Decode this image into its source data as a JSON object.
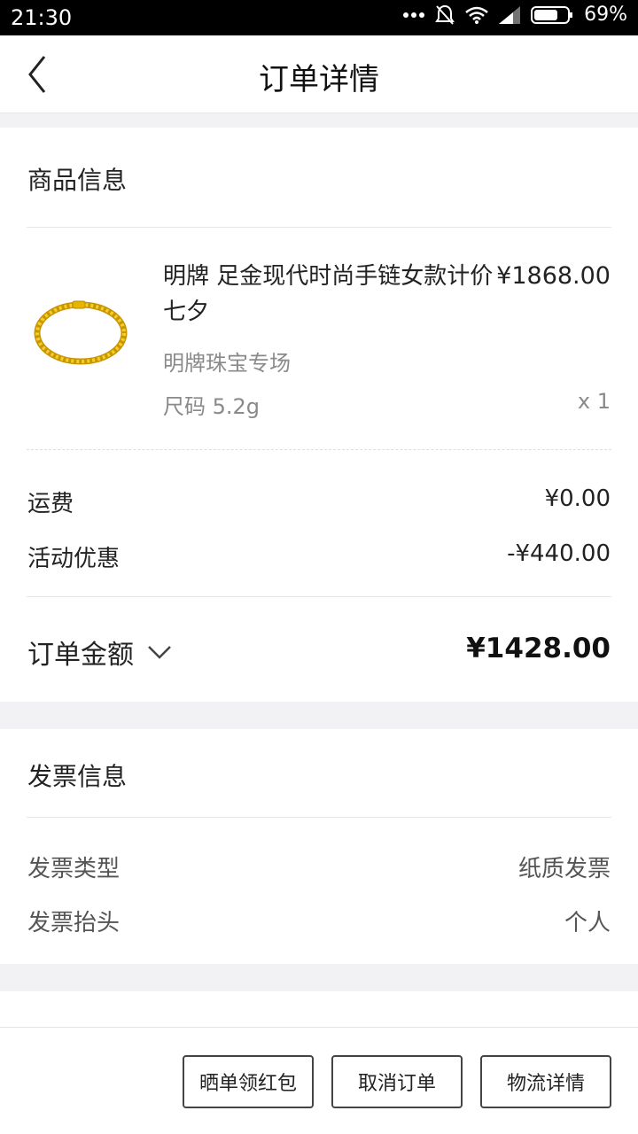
{
  "status_bar": {
    "time": "21:30",
    "battery": "69%",
    "icons": [
      "dots-icon",
      "mute-bell-icon",
      "wifi-icon",
      "signal-icon",
      "battery-icon"
    ]
  },
  "header": {
    "title": "订单详情",
    "back_icon": "chevron-left-icon"
  },
  "goods": {
    "section_title": "商品信息",
    "product": {
      "name": "明牌 足金现代时尚手链女款计价 七夕",
      "price": "¥1868.00",
      "shop": "明牌珠宝专场",
      "spec": "尺码 5.2g",
      "quantity": "x 1",
      "image": "gold-bracelet-image"
    },
    "shipping_label": "运费",
    "shipping_value": "¥0.00",
    "discount_label": "活动优惠",
    "discount_value": "-¥440.00",
    "total_label": "订单金额",
    "total_value": "¥1428.00",
    "total_toggle_icon": "chevron-down-icon"
  },
  "invoice": {
    "section_title": "发票信息",
    "type_label": "发票类型",
    "type_value": "纸质发票",
    "header_label": "发票抬头",
    "header_value": "个人"
  },
  "actions": {
    "share_label": "晒单领红包",
    "cancel_label": "取消订单",
    "logistics_label": "物流详情"
  },
  "colors": {
    "background": "#f2f2f4",
    "card": "#ffffff",
    "gold": "#e7b400",
    "text_primary": "#222222",
    "text_secondary": "#8a8a8a"
  }
}
